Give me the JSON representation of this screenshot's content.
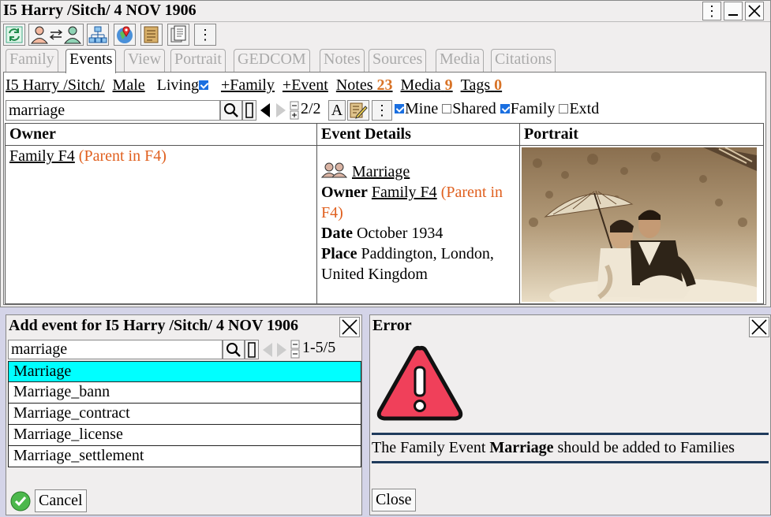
{
  "main": {
    "title": "I5 Harry /Sitch/ 4 NOV 1906",
    "window_buttons": [
      "⋮",
      "—",
      "✕"
    ],
    "tabs": [
      {
        "label": "Family",
        "active": false
      },
      {
        "label": "Events",
        "active": true
      },
      {
        "label": "View",
        "active": false
      },
      {
        "label": "Portrait",
        "active": false
      },
      {
        "label": "GEDCOM",
        "active": false
      },
      {
        "label": "Notes",
        "active": false
      },
      {
        "label": "Sources",
        "active": false
      },
      {
        "label": "Media",
        "active": false
      },
      {
        "label": "Citations",
        "active": false
      }
    ],
    "info": {
      "person": "I5 Harry /Sitch/",
      "sex": "Male",
      "living_label": "Living",
      "add_family": "+Family",
      "add_event": "+Event",
      "notes_label": "Notes",
      "notes_count": "23",
      "media_label": "Media",
      "media_count": "9",
      "tags_label": "Tags",
      "tags_count": "0"
    },
    "search": {
      "value": "marriage",
      "count": "2/2",
      "font_button": "A",
      "mine_label": "Mine",
      "shared_label": "Shared",
      "family_label": "Family",
      "extd_label": "Extd"
    },
    "table": {
      "headers": [
        "Owner",
        "Event Details",
        "Portrait"
      ],
      "owner_link": "Family F4",
      "owner_note": "(Parent in F4)",
      "event_name": "Marriage",
      "owner_label": "Owner",
      "owner_value": "Family F4",
      "owner_value_note": "(Parent in F4)",
      "date_label": "Date",
      "date_value": "October 1934",
      "place_label": "Place",
      "place_value": "Paddington, London, United Kingdom"
    }
  },
  "add_dialog": {
    "title": "Add event for I5 Harry /Sitch/ 4 NOV 1906",
    "search_value": "marriage",
    "count": "1-5/5",
    "items": [
      "Marriage",
      "Marriage_bann",
      "Marriage_contract",
      "Marriage_license",
      "Marriage_settlement"
    ],
    "cancel_label": "Cancel"
  },
  "error_dialog": {
    "title": "Error",
    "message_pre": "The Family Event ",
    "message_bold": "Marriage",
    "message_post": " should be added to Families",
    "close_label": "Close"
  },
  "colors": {
    "accent_orange": "#e0601f",
    "selection": "#00ffff",
    "error_red": "#e8384f"
  }
}
